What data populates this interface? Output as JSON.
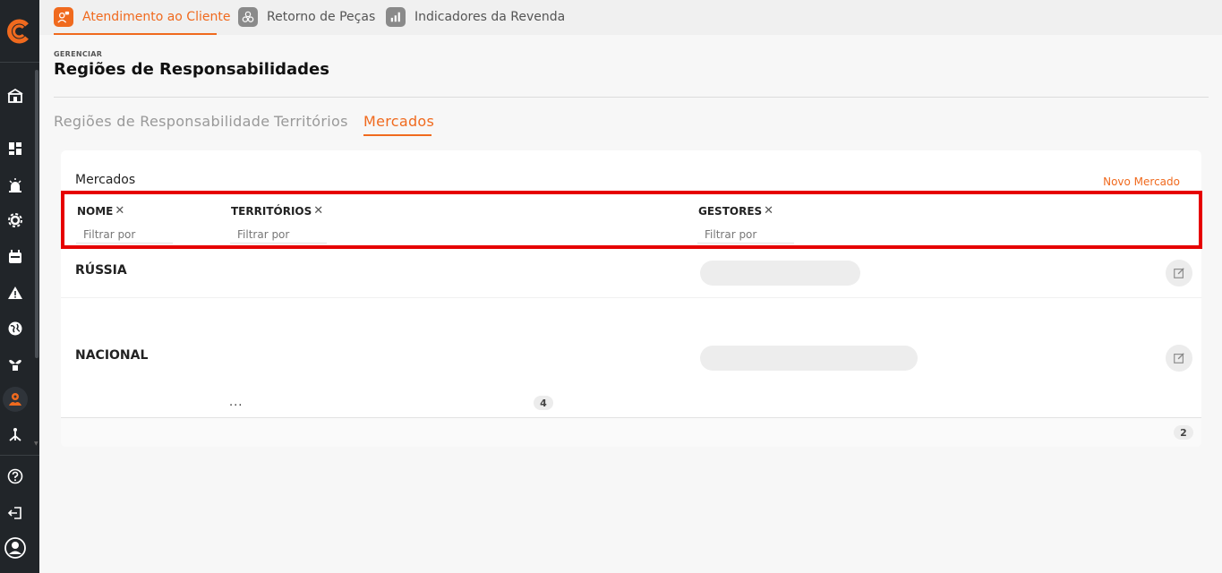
{
  "top_tabs": [
    {
      "label": "Atendimento ao Cliente",
      "active": true
    },
    {
      "label": "Retorno de Peças",
      "active": false
    },
    {
      "label": "Indicadores da Revenda",
      "active": false
    }
  ],
  "breadcrumb": "GERENCIAR",
  "page_title": "Regiões de Responsabilidades",
  "sub_tabs": [
    {
      "label": "Regiões de Responsabilidade",
      "active": false
    },
    {
      "label": "Territórios",
      "active": false
    },
    {
      "label": "Mercados",
      "active": true
    }
  ],
  "card": {
    "title": "Mercados",
    "action_label": "Novo Mercado",
    "columns": [
      {
        "label": "NOME",
        "filter_placeholder": "Filtrar por"
      },
      {
        "label": "TERRITÓRIOS",
        "filter_placeholder": "Filtrar por"
      },
      {
        "label": "GESTORES",
        "filter_placeholder": "Filtrar por"
      }
    ],
    "rows": [
      {
        "name": "RÚSSIA"
      },
      {
        "name": "NACIONAL",
        "territories_more": "...",
        "territories_count": "4"
      }
    ],
    "total_count": "2"
  },
  "colors": {
    "accent": "#f06a1e",
    "sidebar_bg": "#212529",
    "highlight": "#e60000"
  }
}
